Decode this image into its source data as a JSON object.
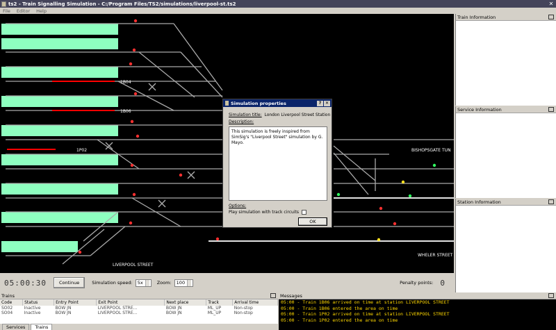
{
  "window": {
    "title": "ts2 - Train Signalling Simulation - C:/Program Files/TS2/simulations/liverpool-st.ts2",
    "close_glyph": "✕"
  },
  "menu": [
    "File",
    "Editor",
    "Help"
  ],
  "canvas": {
    "train_labels": [
      "1B04",
      "1B06",
      "1P02"
    ],
    "place_labels": [
      "BISHOPSGATE TUN",
      "WHELER STREET",
      "LIVERPOOL STREET"
    ]
  },
  "panels": {
    "train_info": "Train Information",
    "service_info": "Service Information",
    "station_info": "Station Information"
  },
  "controls": {
    "clock": "05:00:30",
    "continue_label": "Continue",
    "speed_label": "Simulation speed:",
    "speed_value": "5x",
    "zoom_label": "Zoom:",
    "zoom_value": "100",
    "penalty_label": "Penalty points:",
    "penalty_value": "0"
  },
  "trains": {
    "title": "Trains",
    "columns": [
      "Code",
      "Status",
      "Entry Point",
      "Exit Point",
      "Next place",
      "Track",
      "Arrival time"
    ],
    "rows": [
      [
        "SO02",
        "Inactive",
        "BOW JN",
        "LIVERPOOL STRE...",
        "BOW JN",
        "ML_UP",
        "Non-stop"
      ],
      [
        "SO04",
        "Inactive",
        "BOW JN",
        "LIVERPOOL STRE...",
        "BOW JN",
        "ML_UP",
        "Non-stop"
      ]
    ],
    "tabs": [
      "Services",
      "Trains"
    ]
  },
  "messages": {
    "title": "Messages",
    "lines": [
      "05:00 - Train 1B06 arrived on time at station LIVERPOOL STREET",
      "05:00 - Train 1B06 entered the area on time",
      "05:00 - Train 1P02 arrived on time at station LIVERPOOL STREET",
      "05:00 - Train 1P02 entered the area on time"
    ]
  },
  "dialog": {
    "title": "Simulation properties",
    "sim_title_label": "Simulation title:",
    "sim_title_value": "London Liverpool Street Station",
    "description_label": "Description:",
    "description_text": "This simulation is freely inspired from SimSig's \"Liverpool Street\" simulation by G. Mayo.",
    "options_label": "Options:",
    "track_circuits_label": "Play simulation with track circuits",
    "ok_label": "OK",
    "help_glyph": "?",
    "close_glyph": "✕"
  },
  "colors": {
    "platform": "#8effc0",
    "track": "#aaaaaa",
    "occupied": "#ff0000",
    "signal_red": "#ff3030",
    "message": "#ffd800"
  }
}
